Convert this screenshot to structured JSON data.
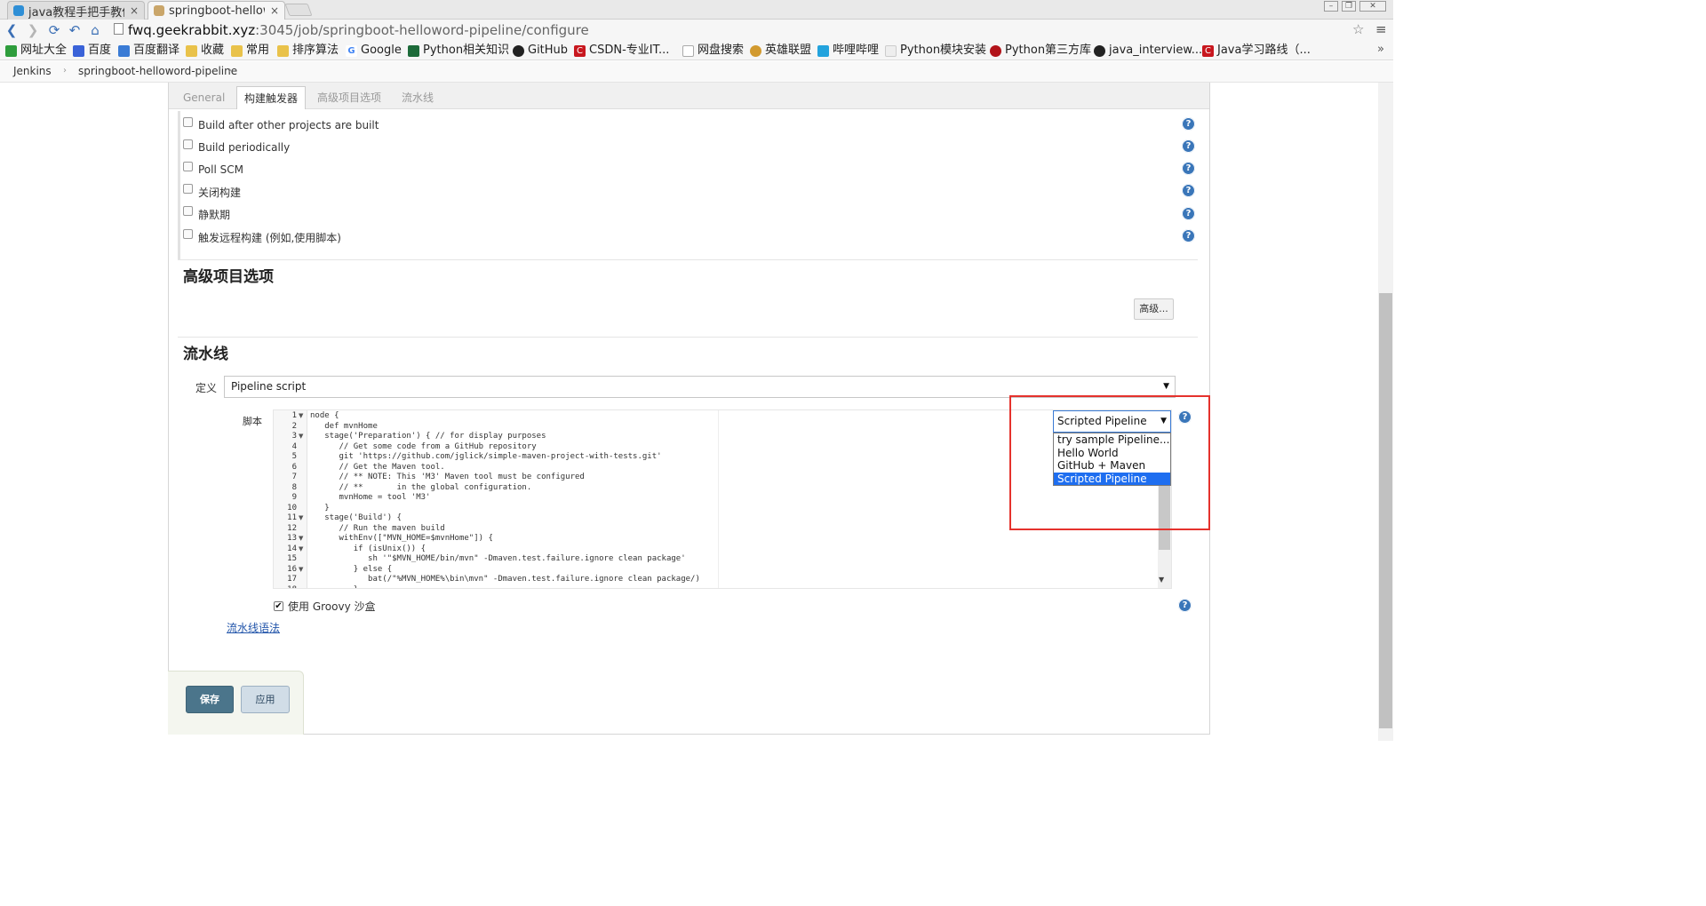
{
  "browser": {
    "tabs": [
      {
        "title": "java教程手把手教你J",
        "close": "×",
        "favicon": "#2f8fd6"
      },
      {
        "title": "springboot-hellow",
        "close": "×",
        "favicon": "#caa66a"
      }
    ],
    "address": {
      "host": "fwq.geekrabbit.xyz",
      "path": ":3045/job/springboot-helloword-pipeline/configure"
    },
    "bookmarks": [
      {
        "label": "网址大全",
        "icon_color": "#2e9d3c",
        "icon": "grid-icon"
      },
      {
        "label": "百度",
        "icon_color": "#3a62d8",
        "icon": "paw-icon"
      },
      {
        "label": "百度翻译",
        "icon_color": "#3a7bd5",
        "icon": "translate-icon"
      },
      {
        "label": "收藏",
        "icon_color": "#e9c24a",
        "icon": "folder-icon"
      },
      {
        "label": "常用",
        "icon_color": "#e9c24a",
        "icon": "folder-icon"
      },
      {
        "label": "排序算法",
        "icon_color": "#e9c24a",
        "icon": "folder-icon"
      },
      {
        "label": "Google",
        "icon_color": "#4285f4",
        "icon": "google-icon"
      },
      {
        "label": "Python相关知识",
        "icon_color": "#1d6b3a",
        "icon": "pycharm-icon"
      },
      {
        "label": "GitHub",
        "icon_color": "#222222",
        "icon": "github-icon"
      },
      {
        "label": "CSDN-专业IT...",
        "icon_color": "#c8171e",
        "icon": "csdn-icon"
      },
      {
        "label": "网盘搜索",
        "icon_color": "#cccccc",
        "icon": "page-icon"
      },
      {
        "label": "英雄联盟",
        "icon_color": "#d29a2f",
        "icon": "lol-icon"
      },
      {
        "label": "哔哩哔哩",
        "icon_color": "#23a3dd",
        "icon": "bilibili-icon"
      },
      {
        "label": "Python模块安装",
        "icon_color": "#eeeeee",
        "icon": "page-icon"
      },
      {
        "label": "Python第三方库",
        "icon_color": "#b2131a",
        "icon": "python-lib-icon"
      },
      {
        "label": "java_interview...",
        "icon_color": "#222222",
        "icon": "github-icon"
      },
      {
        "label": "Java学习路线（...",
        "icon_color": "#c8171e",
        "icon": "csdn-icon"
      }
    ],
    "more": "»"
  },
  "breadcrumb": [
    "Jenkins",
    "springboot-helloword-pipeline"
  ],
  "config_tabs": [
    "General",
    "构建触发器",
    "高级项目选项",
    "流水线"
  ],
  "triggers": [
    "Build after other projects are built",
    "Build periodically",
    "Poll SCM",
    "关闭构建",
    "静默期",
    "触发远程构建 (例如,使用脚本)"
  ],
  "advanced": {
    "title": "高级项目选项",
    "button": "高级..."
  },
  "pipeline": {
    "title": "流水线",
    "definition_label": "定义",
    "definition_value": "Pipeline script",
    "script_label": "脚本",
    "code_lines": [
      "node {",
      "   def mvnHome",
      "   stage('Preparation') { // for display purposes",
      "      // Get some code from a GitHub repository",
      "      git 'https://github.com/jglick/simple-maven-project-with-tests.git'",
      "      // Get the Maven tool.",
      "      // ** NOTE: This 'M3' Maven tool must be configured",
      "      // **       in the global configuration.",
      "      mvnHome = tool 'M3'",
      "   }",
      "   stage('Build') {",
      "      // Run the maven build",
      "      withEnv([\"MVN_HOME=$mvnHome\"]) {",
      "         if (isUnix()) {",
      "            sh '\"$MVN_HOME/bin/mvn\" -Dmaven.test.failure.ignore clean package'",
      "         } else {",
      "            bat(/\"%MVN_HOME%\\bin\\mvn\" -Dmaven.test.failure.ignore clean package/)",
      "         }"
    ],
    "sample_select": {
      "selected": "Scripted Pipeline",
      "options": [
        "try sample Pipeline...",
        "Hello World",
        "GitHub + Maven",
        "Scripted Pipeline"
      ]
    },
    "groovy_sandbox": "使用 Groovy 沙盒",
    "groovy_checked": "✔",
    "syntax_link": "流水线语法"
  },
  "buttons": {
    "save": "保存",
    "apply": "应用"
  },
  "colors": {
    "save_bg": "#4b758b",
    "apply_bg": "#d1dde7",
    "highlight_box": "#e5322d",
    "selected_option": "#1e6ef0"
  }
}
